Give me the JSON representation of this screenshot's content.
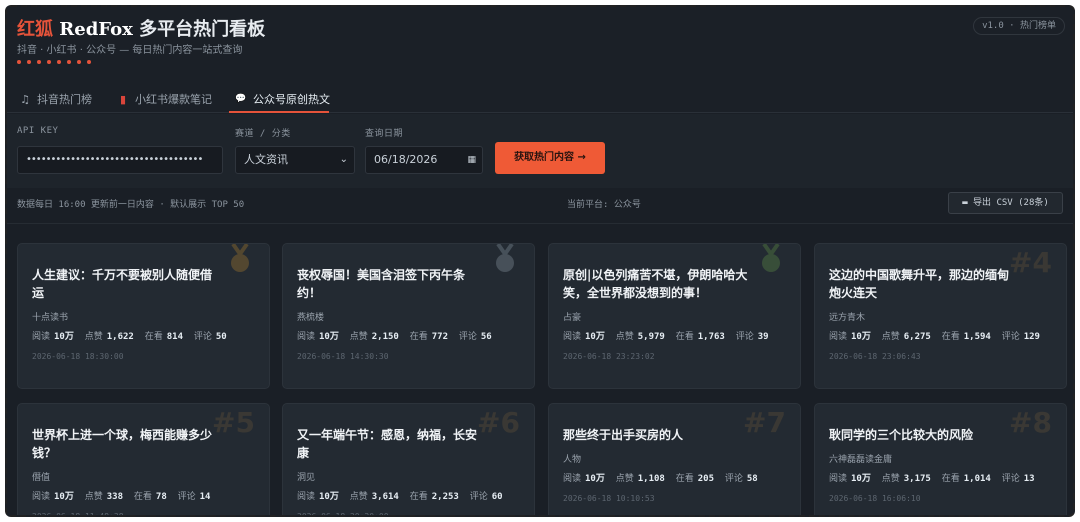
{
  "header": {
    "brand_cn": "红狐",
    "brand_en": "RedFox",
    "brand_rest": "多平台热门看板",
    "subtitle": "抖音 · 小红书 · 公众号 — 每日热门内容一站式查询",
    "version": "v1.0 · 热门榜单"
  },
  "tabs": [
    {
      "label": "抖音热门榜",
      "icon": "music-note-icon"
    },
    {
      "label": "小红书爆款笔记",
      "icon": "book-icon"
    },
    {
      "label": "公众号原创热文",
      "icon": "chat-bubble-icon",
      "active": true
    }
  ],
  "form": {
    "api_key_label": "API KEY",
    "api_key_value": "••••••••••••••••••••••••••••••••••••",
    "category_label": "赛道 / 分类",
    "category_value": "人文资讯",
    "date_label": "查询日期",
    "date_value": "06/18/2026",
    "submit_label": "获取热门内容 →"
  },
  "info": {
    "note": "数据每日 16:00 更新前一日内容 · 默认展示 TOP 50",
    "platform": "当前平台: 公众号",
    "export_label": "导出 CSV (28条)"
  },
  "stat_labels": {
    "read": "阅读",
    "like": "点赞",
    "watch": "在看",
    "comment": "评论"
  },
  "cards": [
    {
      "rank": "1",
      "title": "人生建议：千万不要被别人随便借运",
      "source": "十点读书",
      "read": "10万",
      "like": "1,622",
      "watch": "814",
      "comment": "50",
      "time": "2026-06-18 18:30:00",
      "medal": "#c28a2c"
    },
    {
      "rank": "2",
      "title": "丧权辱国！美国含泪签下丙午条约！",
      "source": "燕梳楼",
      "read": "10万",
      "like": "2,150",
      "watch": "772",
      "comment": "56",
      "time": "2026-06-18 14:30:30",
      "medal": "#9aa8b5"
    },
    {
      "rank": "3",
      "title": "原创|以色列痛苦不堪，伊朗哈哈大笑，全世界都没想到的事！",
      "source": "占豪",
      "read": "10万",
      "like": "5,979",
      "watch": "1,763",
      "comment": "39",
      "time": "2026-06-18 23:23:02",
      "medal": "#6aa14a"
    },
    {
      "rank": "#4",
      "title": "这边的中国歌舞升平，那边的缅甸炮火连天",
      "source": "远方青木",
      "read": "10万",
      "like": "6,275",
      "watch": "1,594",
      "comment": "129",
      "time": "2026-06-18 23:06:43"
    },
    {
      "rank": "#5",
      "title": "世界杯上进一个球，梅西能赚多少钱？",
      "source": "僭值",
      "read": "10万",
      "like": "338",
      "watch": "78",
      "comment": "14",
      "time": "2026-06-18 11:49:38"
    },
    {
      "rank": "#6",
      "title": "又一年端午节：感恩，纳福，长安康",
      "source": "洞见",
      "read": "10万",
      "like": "3,614",
      "watch": "2,253",
      "comment": "60",
      "time": "2026-06-18 20:20:00"
    },
    {
      "rank": "#7",
      "title": "那些终于出手买房的人",
      "source": "人物",
      "read": "10万",
      "like": "1,108",
      "watch": "205",
      "comment": "58",
      "time": "2026-06-18 10:10:53"
    },
    {
      "rank": "#8",
      "title": "耿同学的三个比较大的风险",
      "source": "六神磊磊读金庸",
      "read": "10万",
      "like": "3,175",
      "watch": "1,014",
      "comment": "13",
      "time": "2026-06-18 16:06:10"
    }
  ],
  "colors": {
    "accent": "#e5533a",
    "button": "#ef5a36",
    "background": "#1a1f26",
    "card": "#232a32"
  }
}
